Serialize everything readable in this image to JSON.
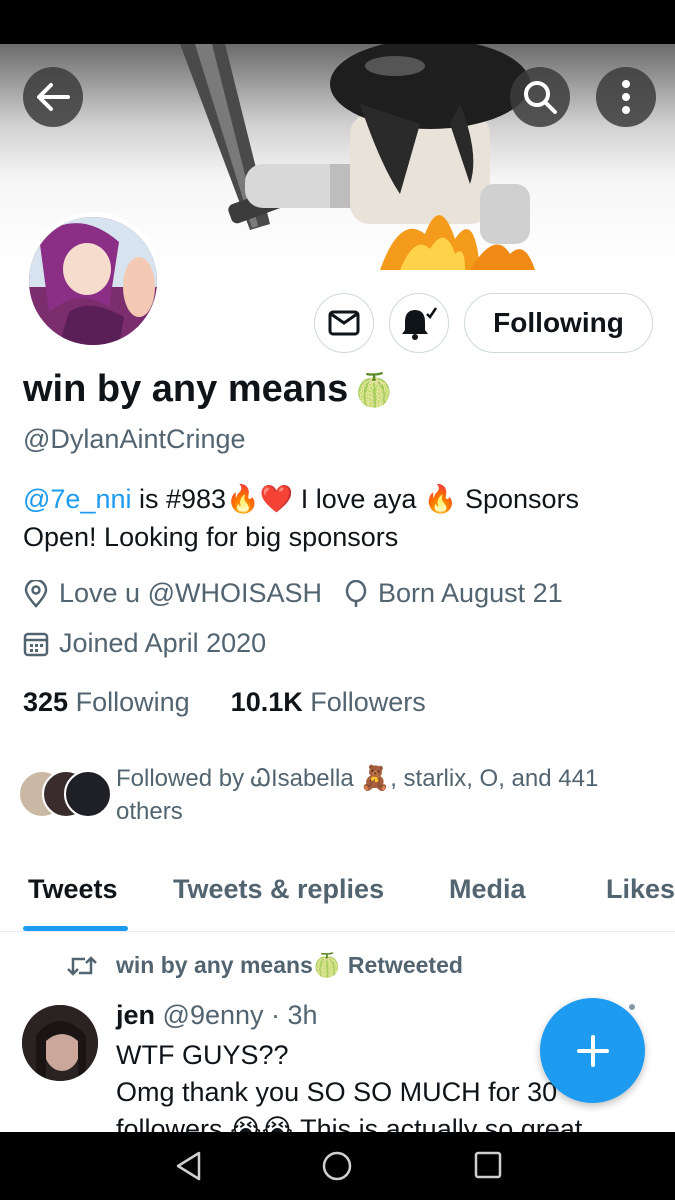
{
  "header": {
    "back_icon": "arrow-left-icon",
    "search_icon": "search-icon",
    "more_icon": "more-vertical-icon"
  },
  "profile": {
    "display_name": "win by any means",
    "name_emoji": "🍈",
    "handle": "@DylanAintCringe",
    "bio_mention": "@7e_nni",
    "bio_line1_rest": " is #983🔥❤️ I love aya 🔥 Sponsors",
    "bio_line2": "Open! Looking for big sponsors",
    "location": "Love u @WHOISASH",
    "birthday": "Born August 21",
    "joined": "Joined April 2020",
    "following_count": "325",
    "following_label": "Following",
    "followers_count": "10.1K",
    "followers_label": "Followers",
    "followed_by": "Followed by ᏇIsabella 🧸, starlix, O, and 441 others"
  },
  "actions": {
    "message_icon": "envelope-icon",
    "notify_icon": "bell-check-icon",
    "follow_label": "Following"
  },
  "tabs": [
    {
      "label": "Tweets",
      "active": true
    },
    {
      "label": "Tweets & replies",
      "active": false
    },
    {
      "label": "Media",
      "active": false
    },
    {
      "label": "Likes",
      "active": false
    }
  ],
  "tweet": {
    "retweet_label": "win by any means🍈 Retweeted",
    "author_name": "jen",
    "author_handle_time": "@9enny · 3h",
    "line1": "WTF GUYS??",
    "line2": "Omg thank you SO SO MUCH for 30",
    "line3": "followers 😭😭 This is actually so great"
  },
  "colors": {
    "accent": "#1d9bf0",
    "secondary_text": "#536471",
    "primary_text": "#0f1419"
  }
}
